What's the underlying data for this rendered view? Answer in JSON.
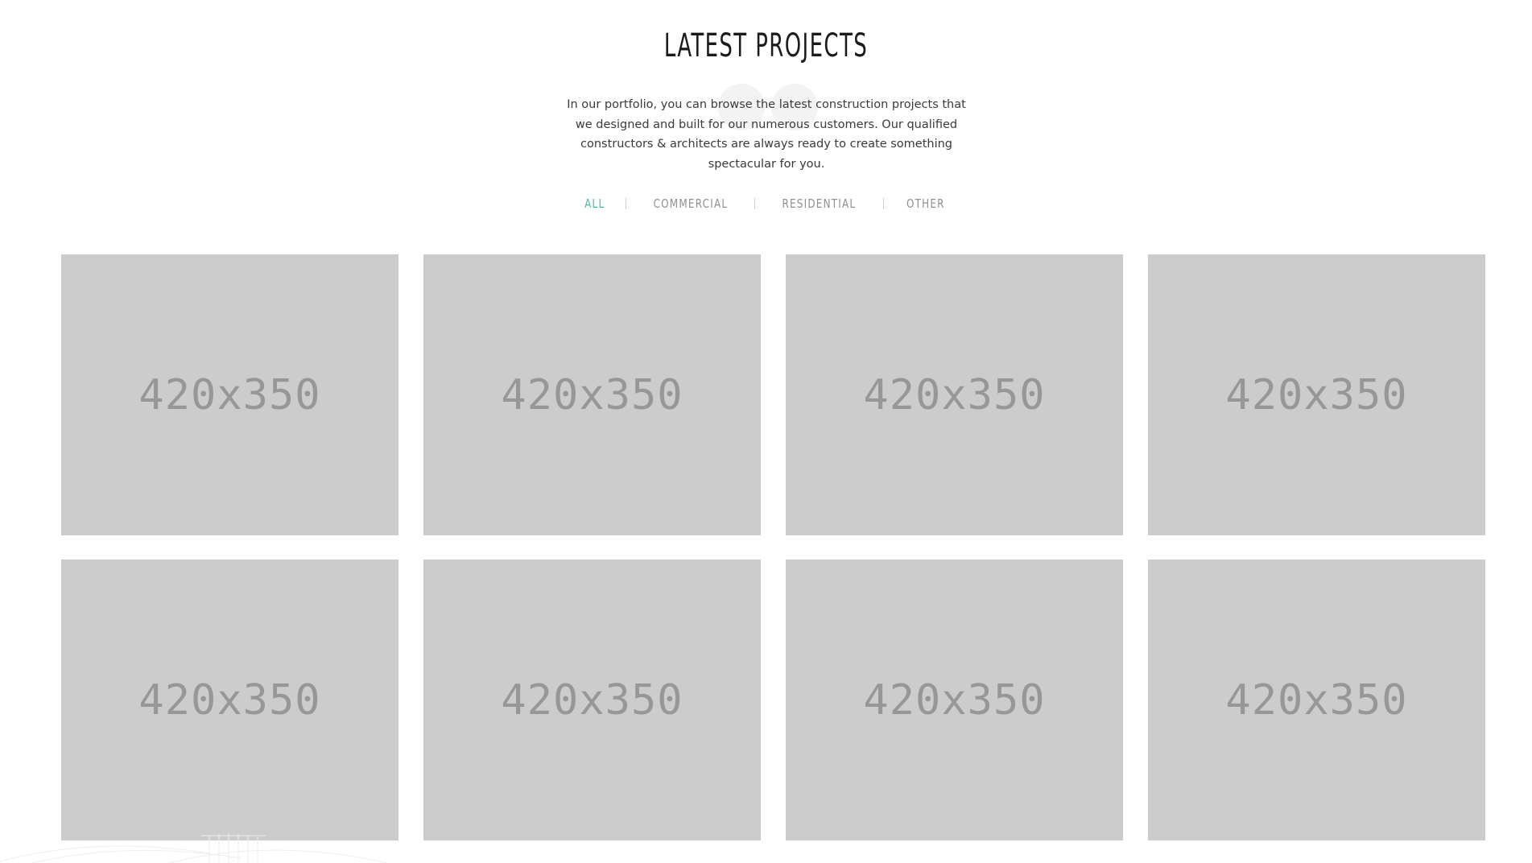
{
  "section": {
    "title": "LATEST PROJECTS",
    "intro": "In our portfolio, you can browse the latest construction projects that we designed and built for our numerous customers. Our qualified constructors & architects are always ready to create something spectacular for you."
  },
  "filters": [
    {
      "label": "ALL",
      "active": true
    },
    {
      "label": "COMMERCIAL",
      "active": false
    },
    {
      "label": "RESIDENTIAL",
      "active": false
    },
    {
      "label": "OTHER",
      "active": false
    }
  ],
  "projects": [
    {
      "placeholder": "420x350"
    },
    {
      "placeholder": "420x350"
    },
    {
      "placeholder": "420x350"
    },
    {
      "placeholder": "420x350"
    },
    {
      "placeholder": "420x350"
    },
    {
      "placeholder": "420x350"
    },
    {
      "placeholder": "420x350"
    },
    {
      "placeholder": "420x350"
    }
  ],
  "colors": {
    "accent": "#57b79c",
    "tile_bg": "#cccccc",
    "tile_text": "#979797",
    "filter_text": "#8f8f8f",
    "title_text": "#1b1b1b"
  }
}
